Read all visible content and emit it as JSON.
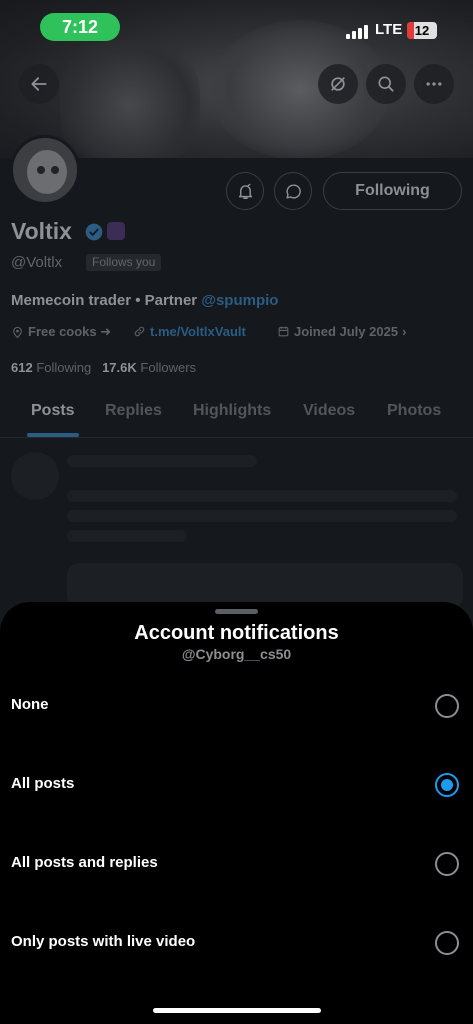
{
  "status": {
    "time": "7:12",
    "network": "LTE",
    "battery": "12"
  },
  "profile": {
    "name": "Voltix",
    "handle": "@Voltlx",
    "follows_you": "Follows you",
    "bio_text": "Memecoin trader • Partner ",
    "bio_mention": "@spumpio",
    "location": "Free cooks ➜",
    "link": "t.me/VoltlxVault",
    "joined": "Joined July 2025",
    "following_count": "612",
    "following_label": " Following",
    "followers_count": "17.6K",
    "followers_label": " Followers",
    "following_button": "Following"
  },
  "tabs": [
    "Posts",
    "Replies",
    "Highlights",
    "Videos",
    "Photos"
  ],
  "sheet": {
    "title": "Account notifications",
    "subtitle": "@Cyborg__cs50",
    "options": [
      {
        "label": "None",
        "checked": false
      },
      {
        "label": "All posts",
        "checked": true
      },
      {
        "label": "All posts and replies",
        "checked": false
      },
      {
        "label": "Only posts with live video",
        "checked": false
      }
    ]
  },
  "colors": {
    "accent": "#1d9bf0",
    "time_pill": "#2fc25a",
    "battery_low": "#e23b3b"
  },
  "icons": [
    "back-arrow-icon",
    "hide-icon",
    "search-icon",
    "more-icon",
    "notification-bell-icon",
    "message-icon",
    "verified-badge-icon",
    "location-icon",
    "link-icon",
    "calendar-icon"
  ]
}
